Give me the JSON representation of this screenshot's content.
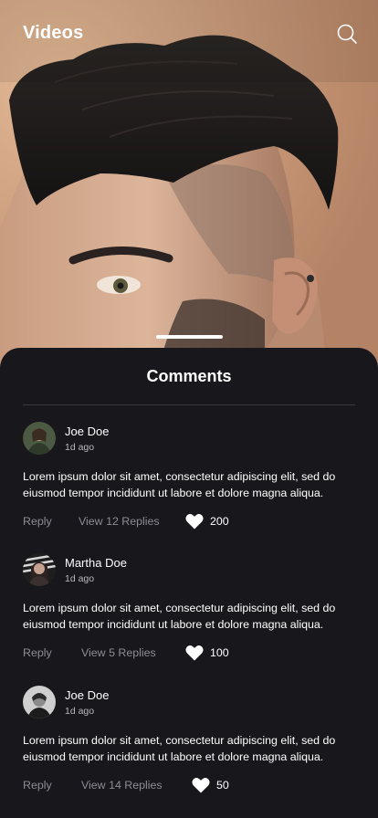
{
  "header": {
    "title": "Videos",
    "search_icon": "search-icon"
  },
  "sheet": {
    "title": "Comments"
  },
  "comments": [
    {
      "author": "Joe Doe",
      "time": "1d ago",
      "text": "Lorem ipsum dolor sit amet, consectetur adipiscing elit, sed do eiusmod tempor incididunt ut labore et dolore magna aliqua.",
      "reply_label": "Reply",
      "replies_label": "View 12 Replies",
      "likes": "200",
      "like_icon": "heart-icon"
    },
    {
      "author": "Martha Doe",
      "time": "1d ago",
      "text": "Lorem ipsum dolor sit amet, consectetur adipiscing elit, sed do eiusmod tempor incididunt ut labore et dolore magna aliqua.",
      "reply_label": "Reply",
      "replies_label": "View 5 Replies",
      "likes": "100",
      "like_icon": "heart-icon"
    },
    {
      "author": "Joe Doe",
      "time": "1d ago",
      "text": "Lorem ipsum dolor sit amet, consectetur adipiscing elit, sed do eiusmod tempor incididunt ut labore et dolore magna aliqua.",
      "reply_label": "Reply",
      "replies_label": "View 14 Replies",
      "likes": "50",
      "like_icon": "heart-icon"
    }
  ],
  "colors": {
    "background": "#18171c",
    "muted_text": "#8d8c92",
    "divider": "#3a3940",
    "accent": "#ffffff"
  }
}
